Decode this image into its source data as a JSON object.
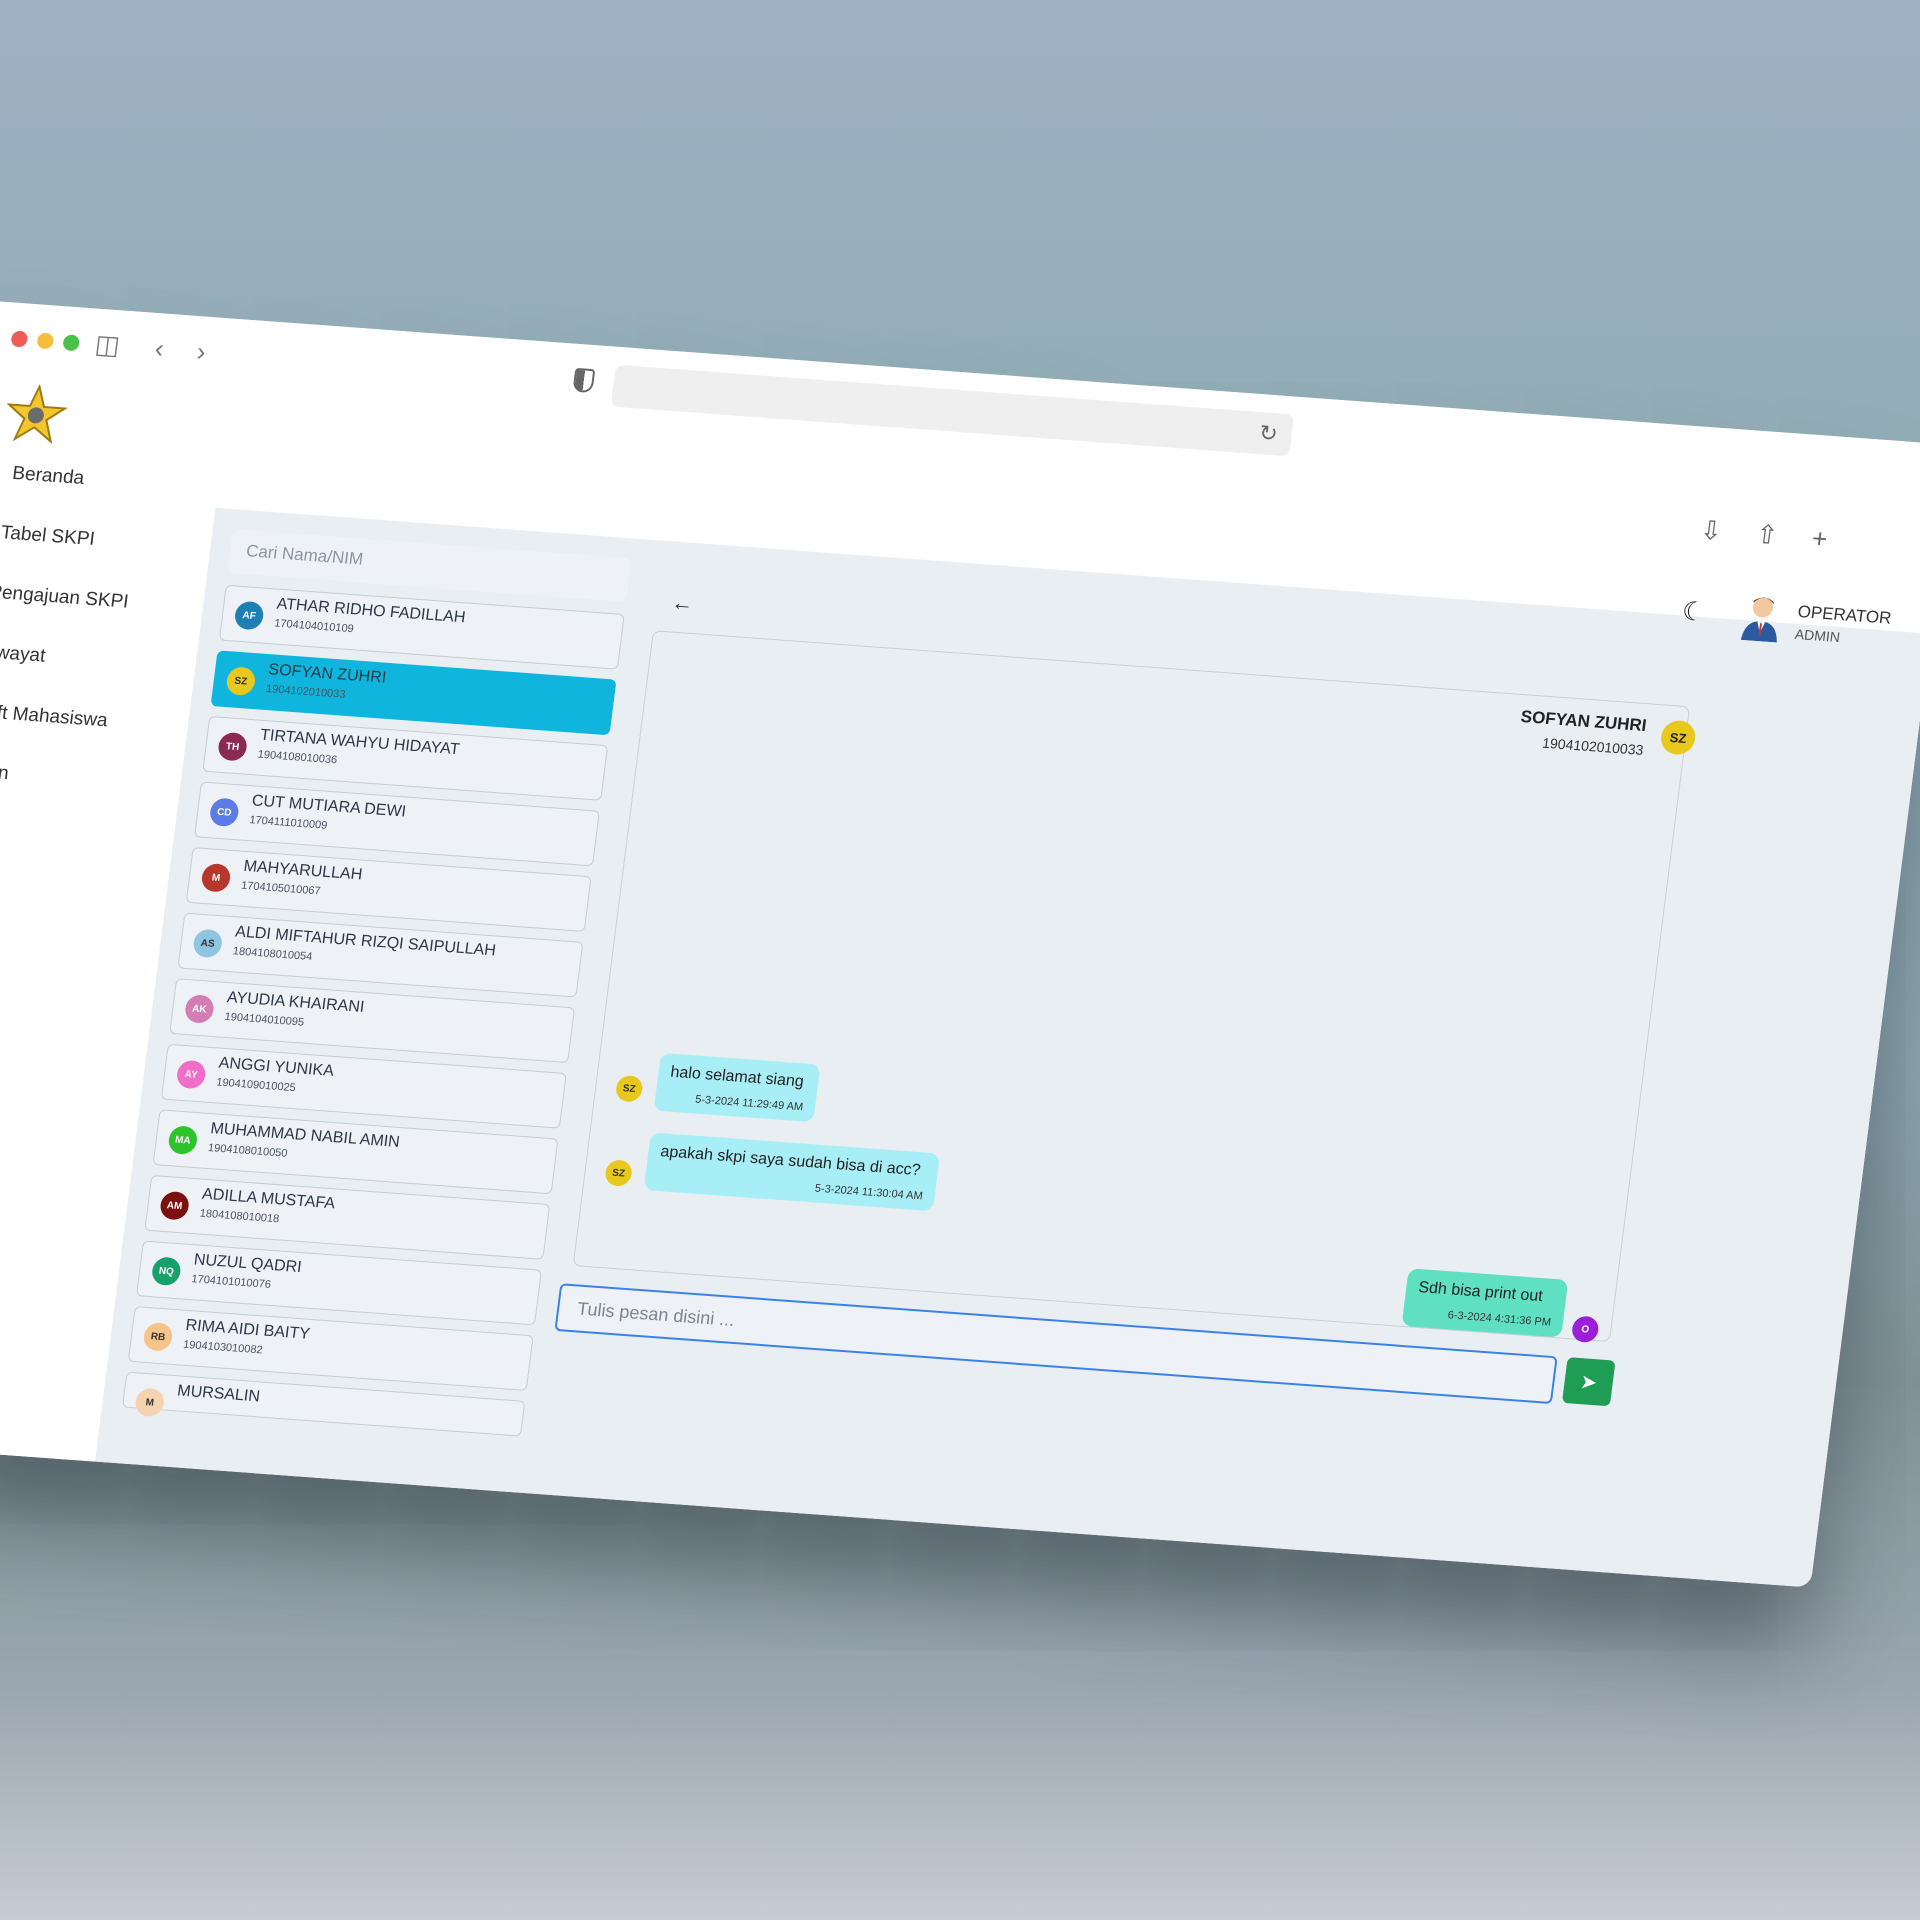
{
  "sidebar": {
    "items": [
      {
        "label": "Beranda",
        "icon": "home-icon"
      },
      {
        "label": "Tabel SKPI",
        "icon": "table-icon"
      },
      {
        "label": "Pengajuan SKPI",
        "icon": "file-icon"
      },
      {
        "label": "Riwayat",
        "icon": "history-icon"
      },
      {
        "label": "Draft Mahasiswa",
        "icon": "draft-icon"
      },
      {
        "label": "Pesan",
        "icon": "message-icon"
      }
    ]
  },
  "search": {
    "placeholder": "Cari Nama/NIM"
  },
  "contacts": [
    {
      "initials": "AF",
      "name": "ATHAR RIDHO FADILLAH",
      "nim": "1704104010109",
      "color": "#1e7fb5"
    },
    {
      "initials": "SZ",
      "name": "SOFYAN ZUHRI",
      "nim": "1904102010033",
      "color": "#e8c81c"
    },
    {
      "initials": "TH",
      "name": "TIRTANA WAHYU HIDAYAT",
      "nim": "1904108010036",
      "color": "#8b2a52"
    },
    {
      "initials": "CD",
      "name": "CUT MUTIARA DEWI",
      "nim": "1704111010009",
      "color": "#5b7be8"
    },
    {
      "initials": "M",
      "name": "MAHYARULLAH",
      "nim": "1704105010067",
      "color": "#b8362b"
    },
    {
      "initials": "AS",
      "name": "ALDI MIFTAHUR RIZQI SAIPULLAH",
      "nim": "1804108010054",
      "color": "#8fc5e0"
    },
    {
      "initials": "AK",
      "name": "AYUDIA KHAIRANI",
      "nim": "1904104010095",
      "color": "#d47cb4"
    },
    {
      "initials": "AY",
      "name": "ANGGI YUNIKA",
      "nim": "1904109010025",
      "color": "#f06ec8"
    },
    {
      "initials": "MA",
      "name": "MUHAMMAD NABIL AMIN",
      "nim": "1904108010050",
      "color": "#2bc42b"
    },
    {
      "initials": "AM",
      "name": "ADILLA MUSTAFA",
      "nim": "1804108010018",
      "color": "#7a1010"
    },
    {
      "initials": "NQ",
      "name": "NUZUL QADRI",
      "nim": "1704101010076",
      "color": "#18a06a"
    },
    {
      "initials": "RB",
      "name": "RIMA AIDI BAITY",
      "nim": "1904103010082",
      "color": "#f5c48a"
    },
    {
      "initials": "M",
      "name": "MURSALIN",
      "nim": "",
      "color": "#f5d2b0"
    }
  ],
  "header": {
    "user_role": "OPERATOR",
    "user_sub": "ADMIN"
  },
  "chat": {
    "partner_name": "SOFYAN ZUHRI",
    "partner_nim": "1904102010033",
    "partner_initials": "SZ",
    "messages": [
      {
        "from": "SZ",
        "text": "halo selamat siang",
        "time": "5-3-2024 11:29:49 AM"
      },
      {
        "from": "SZ",
        "text": "apakah skpi saya sudah bisa di acc?",
        "time": "5-3-2024 11:30:04 AM"
      },
      {
        "from": "O",
        "text": "Sdh bisa print out",
        "time": "6-3-2024 4:31:36 PM"
      }
    ],
    "input_placeholder": "Tulis pesan disini ..."
  }
}
